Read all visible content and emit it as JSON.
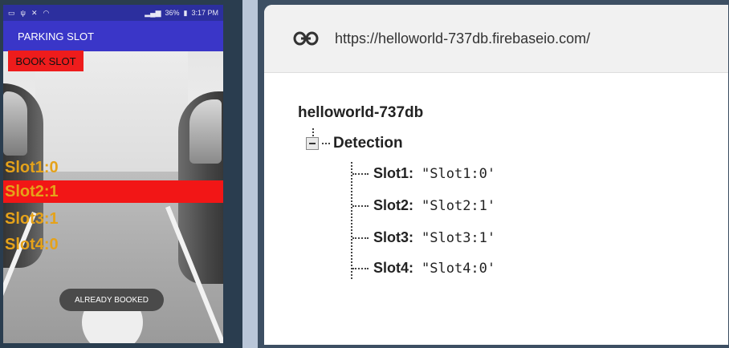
{
  "phone": {
    "statusbar": {
      "battery": "36%",
      "time": "3:17 PM"
    },
    "app_title": "PARKING SLOT",
    "book_button": "BOOK SLOT",
    "slots": [
      {
        "label": "Slot1:0",
        "booked": false
      },
      {
        "label": "Slot2:1",
        "booked": true
      },
      {
        "label": "Slot3:1",
        "booked": false
      },
      {
        "label": "Slot4:0",
        "booked": false
      }
    ],
    "toast": "ALREADY BOOKED"
  },
  "browser": {
    "url": "https://helloworld-737db.firebaseio.com/",
    "root": "helloworld-737db",
    "node": "Detection",
    "children": [
      {
        "key": "Slot1:",
        "value": "\"Slot1:0'"
      },
      {
        "key": "Slot2:",
        "value": "\"Slot2:1'"
      },
      {
        "key": "Slot3:",
        "value": "\"Slot3:1'"
      },
      {
        "key": "Slot4:",
        "value": "\"Slot4:0'"
      }
    ]
  },
  "colors": {
    "appbar": "#3a36c8",
    "book_button": "#ee1c1c",
    "slot_text": "#e5a21a",
    "slot_booked_bg": "#f21616"
  }
}
